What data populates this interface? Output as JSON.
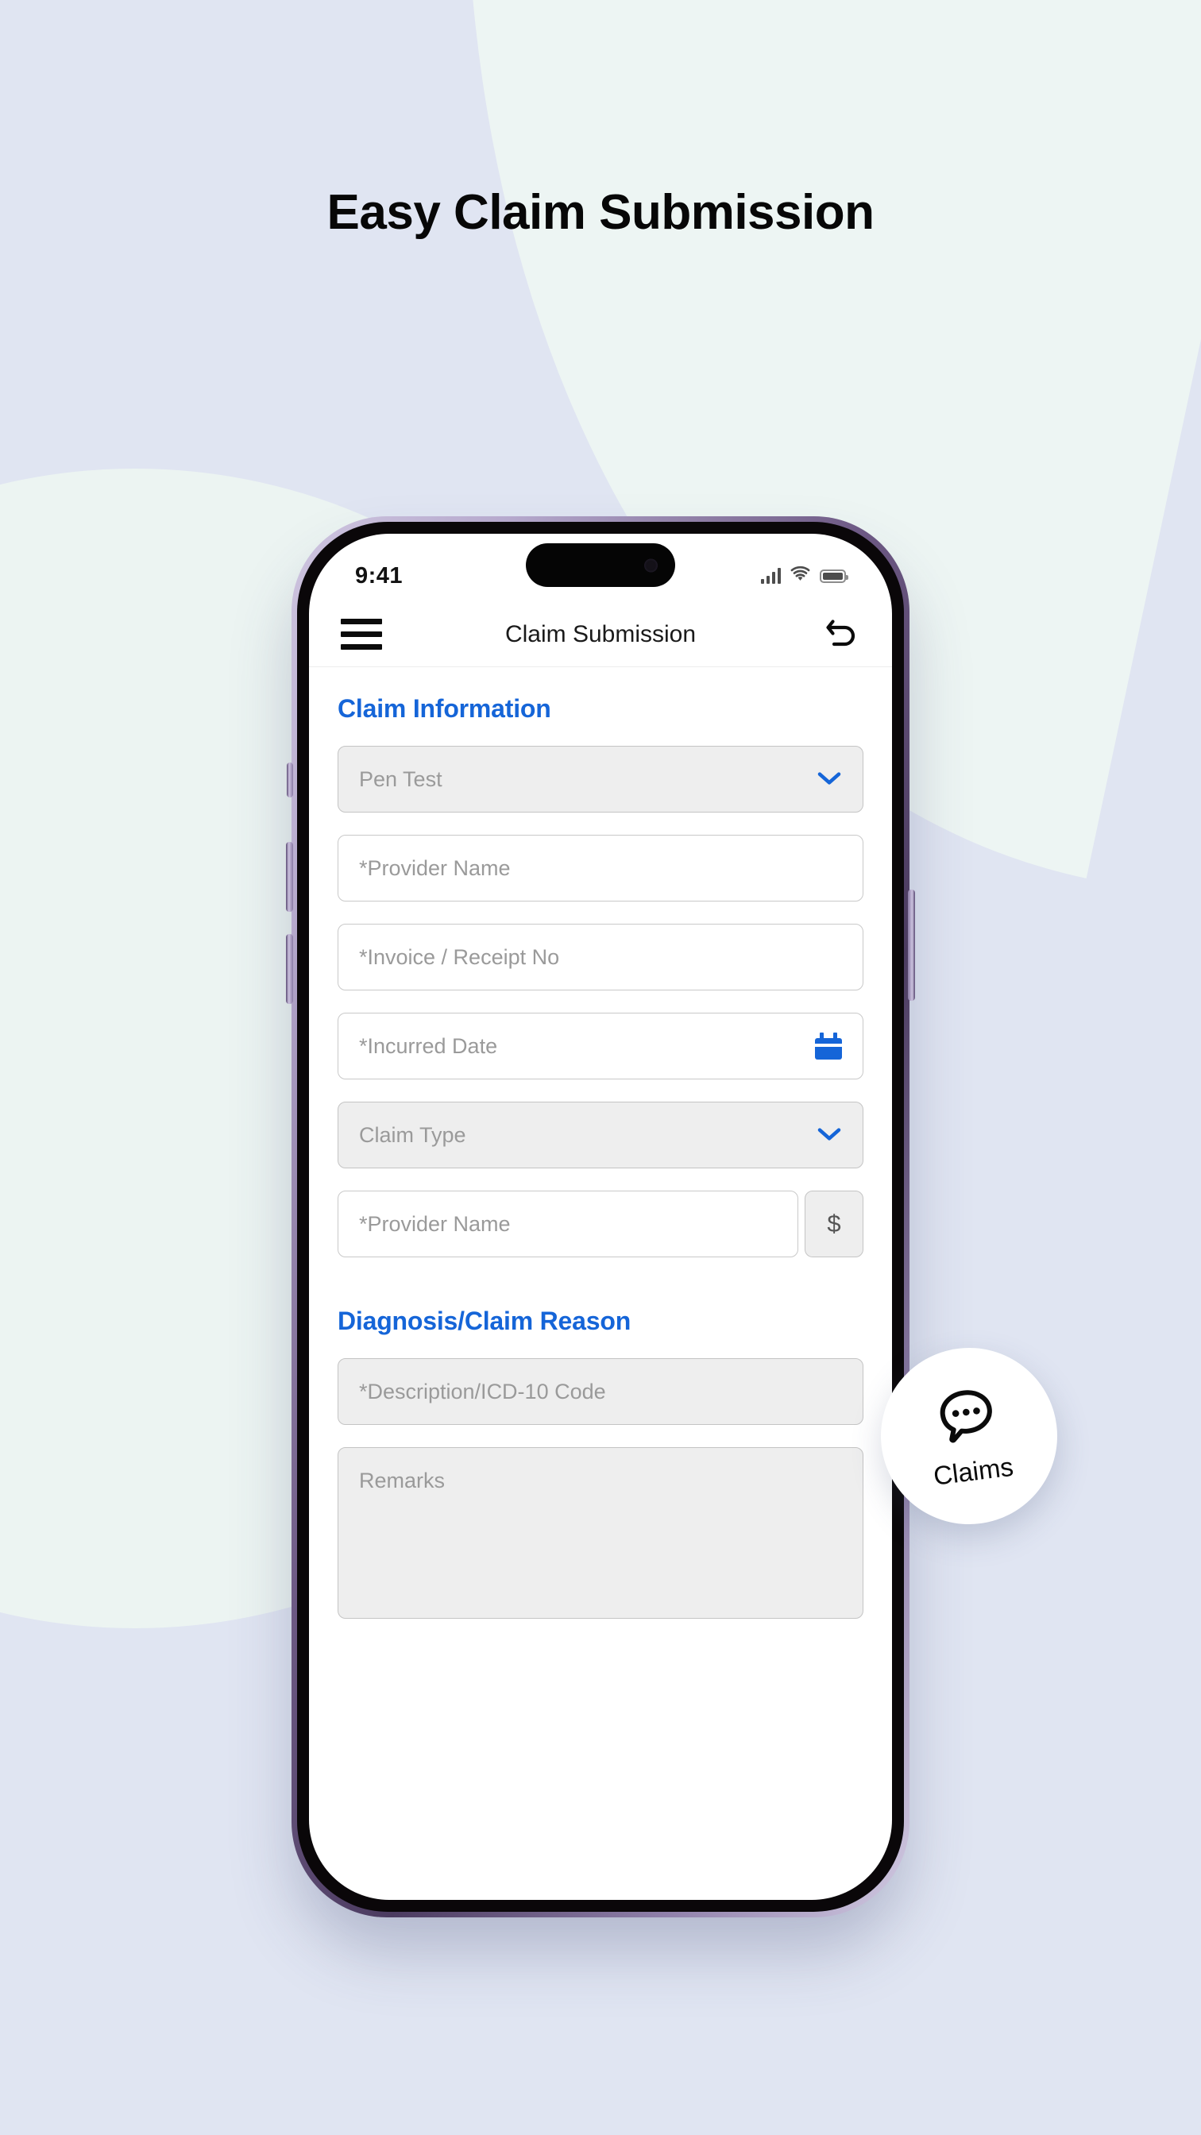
{
  "page": {
    "headline": "Easy Claim Submission",
    "background_color": "#e0e5f2",
    "accent_color": "#1565d8",
    "mint_color": "#ecf4f2"
  },
  "status_bar": {
    "time": "9:41",
    "signal_icon": "cellular-signal-icon",
    "wifi_icon": "wifi-icon",
    "battery_icon": "battery-icon"
  },
  "nav": {
    "menu_icon": "hamburger-menu-icon",
    "title": "Claim Submission",
    "back_icon": "undo-back-arrow-icon"
  },
  "form": {
    "sections": [
      {
        "title": "Claim Information",
        "fields": [
          {
            "name": "pen-test-dropdown",
            "label": "Pen Test",
            "type": "select",
            "style": "filled",
            "icon": "chevron-down-icon"
          },
          {
            "name": "provider-name-field",
            "label": "*Provider Name",
            "type": "text",
            "style": "outline"
          },
          {
            "name": "invoice-receipt-no-field",
            "label": "*Invoice / Receipt No",
            "type": "text",
            "style": "outline"
          },
          {
            "name": "incurred-date-field",
            "label": "*Incurred Date",
            "type": "date",
            "style": "outline",
            "icon": "calendar-icon"
          },
          {
            "name": "claim-type-dropdown",
            "label": "Claim Type",
            "type": "select",
            "style": "filled",
            "icon": "chevron-down-icon"
          },
          {
            "name": "amount-field",
            "label": "*Provider Name",
            "type": "amount",
            "style": "outline",
            "suffix": "$"
          }
        ]
      },
      {
        "title": "Diagnosis/Claim Reason",
        "fields": [
          {
            "name": "description-icd10-field",
            "label": "*Description/ICD-10 Code",
            "type": "text",
            "style": "filled"
          },
          {
            "name": "remarks-textarea",
            "label": "Remarks",
            "type": "textarea",
            "style": "filled"
          }
        ]
      }
    ]
  },
  "floating_badge": {
    "icon": "chat-bubble-dots-icon",
    "label": "Claims"
  }
}
